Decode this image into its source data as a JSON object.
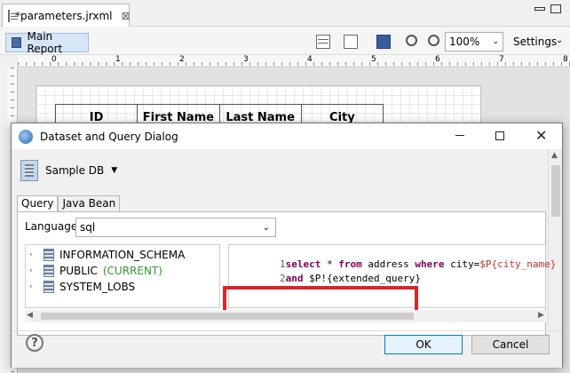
{
  "editor": {
    "tab_title": "*parameters.jrxml",
    "tab_close": "⊠",
    "main_report_label": "Main Report",
    "zoom_value": "100%",
    "settings_label": "Settings",
    "ruler_numbers": [
      "0",
      "1",
      "2",
      "3",
      "4",
      "5",
      "6",
      "7",
      "8"
    ],
    "table_headers": [
      "ID",
      "First Name",
      "Last Name",
      "City"
    ]
  },
  "dialog": {
    "title": "Dataset and Query Dialog",
    "data_adapter": "Sample DB",
    "tabs": [
      "Query",
      "Java Bean"
    ],
    "active_tab": "Query",
    "language_label": "Language",
    "language_value": "sql",
    "tree_items": [
      {
        "label": "INFORMATION_SCHEMA",
        "suffix": ""
      },
      {
        "label": "PUBLIC",
        "suffix": "(CURRENT)"
      },
      {
        "label": "SYSTEM_LOBS",
        "suffix": ""
      }
    ],
    "query_lines": [
      {
        "num": "1",
        "parts": [
          {
            "t": "select",
            "c": "kw"
          },
          {
            "t": " * ",
            "c": "op"
          },
          {
            "t": "from",
            "c": "kw"
          },
          {
            "t": " address ",
            "c": "op"
          },
          {
            "t": "where",
            "c": "kw"
          },
          {
            "t": " city=",
            "c": "op"
          },
          {
            "t": "$P{city_name}",
            "c": "param"
          }
        ]
      },
      {
        "num": "2",
        "parts": [
          {
            "t": "and",
            "c": "kw"
          },
          {
            "t": " $P!{extended_query}",
            "c": "op"
          }
        ]
      }
    ],
    "ok_label": "OK",
    "cancel_label": "Cancel"
  },
  "colors": {
    "highlight_border": "#d9262b",
    "keyword": "#7f0055",
    "parameter": "#c03030",
    "current_schema": "#2f9a2f"
  },
  "icons": [
    "file-icon",
    "report-icon",
    "grid-icon",
    "number-icon",
    "save-icon",
    "zoom-in-icon",
    "zoom-out-icon",
    "app-icon",
    "database-icon",
    "table-icon",
    "help-icon"
  ]
}
